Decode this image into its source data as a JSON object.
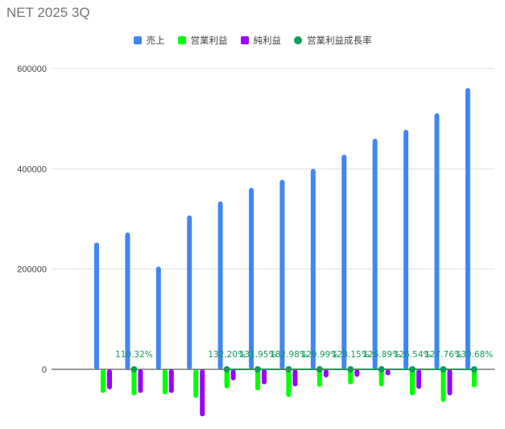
{
  "chart_data": {
    "type": "bar",
    "title": "NET 2025 3Q",
    "xlabel": "",
    "ylabel": "",
    "ylim": [
      -100000,
      600000
    ],
    "yticks": [
      0,
      200000,
      400000,
      600000
    ],
    "ytick_labels": [
      "0",
      "200000",
      "400000",
      "600000"
    ],
    "grid": true,
    "legend_position": "top-center",
    "categories": [
      "",
      "",
      "",
      "",
      "",
      "",
      "",
      "",
      "",
      "",
      "",
      "",
      ""
    ],
    "series": [
      {
        "name": "売上",
        "type": "bar",
        "color": "#4285f4",
        "values": [
          253000,
          273000,
          205000,
          307000,
          335000,
          362000,
          378000,
          400000,
          428000,
          460000,
          478000,
          511000,
          561000
        ]
      },
      {
        "name": "営業利益",
        "type": "bar",
        "color": "#00ff00",
        "values": [
          -47000,
          -52000,
          -50000,
          -57000,
          -38000,
          -42000,
          -55000,
          -35000,
          -30000,
          -34000,
          -52000,
          -65000,
          -36000
        ]
      },
      {
        "name": "純利益",
        "type": "bar",
        "color": "#9900ff",
        "values": [
          -40000,
          -47000,
          -47000,
          -94000,
          -22000,
          -30000,
          -34000,
          -16000,
          -15000,
          -12000,
          -39000,
          -52000,
          0
        ]
      },
      {
        "name": "営業利益成長率",
        "type": "line",
        "color": "#0f9d58",
        "values": [
          null,
          0,
          null,
          null,
          0,
          0,
          0,
          0,
          0,
          0,
          0,
          0,
          0
        ],
        "labels": [
          "",
          "110.32%",
          "",
          "",
          "132.20%",
          "131.95%",
          "182.98%",
          "129.99%",
          "128.15%",
          "126.89%",
          "126.54%",
          "127.76%",
          "130.68%"
        ]
      }
    ]
  }
}
